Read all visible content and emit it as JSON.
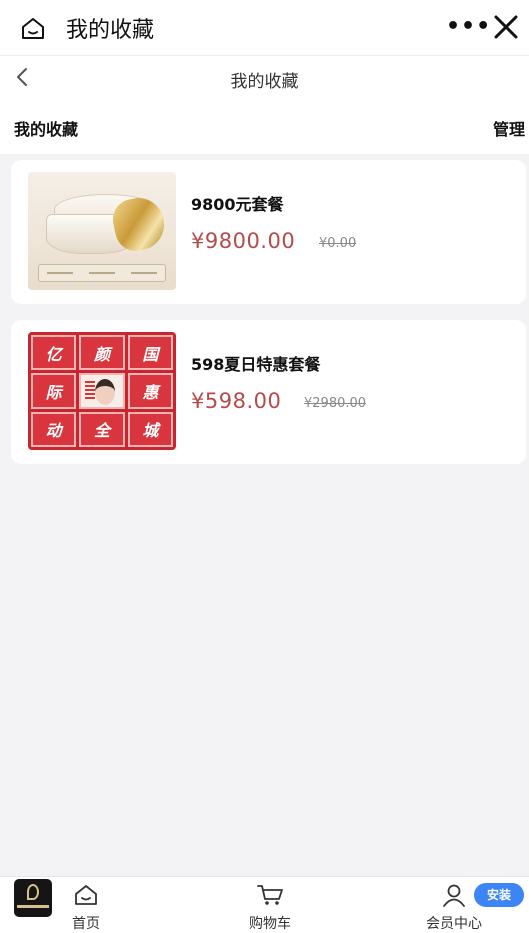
{
  "window": {
    "title": "我的收藏",
    "more_label": "•••"
  },
  "navbar": {
    "title": "我的收藏"
  },
  "section": {
    "label": "我的收藏",
    "manage_label": "管理"
  },
  "favorites": [
    {
      "name": "9800元套餐",
      "price": "¥9800.00",
      "original_price": "¥0.00",
      "image_icon": "cream-jar-product-image"
    },
    {
      "name": "598夏日特惠套餐",
      "price": "¥598.00",
      "original_price": "¥2980.00",
      "image_icon": "promo-grid-product-image",
      "image_chars": [
        "亿",
        "颜",
        "国",
        "际",
        "",
        "惠",
        "动",
        "全",
        "城"
      ]
    }
  ],
  "tabs": [
    {
      "label": "首页",
      "icon": "home-icon"
    },
    {
      "label": "购物车",
      "icon": "cart-icon"
    },
    {
      "label": "会员中心",
      "icon": "user-icon"
    }
  ],
  "install_label": "安装",
  "colors": {
    "price": "#b64a4a",
    "install_badge": "#3d84f4",
    "page_bg": "#f3f3f5"
  }
}
